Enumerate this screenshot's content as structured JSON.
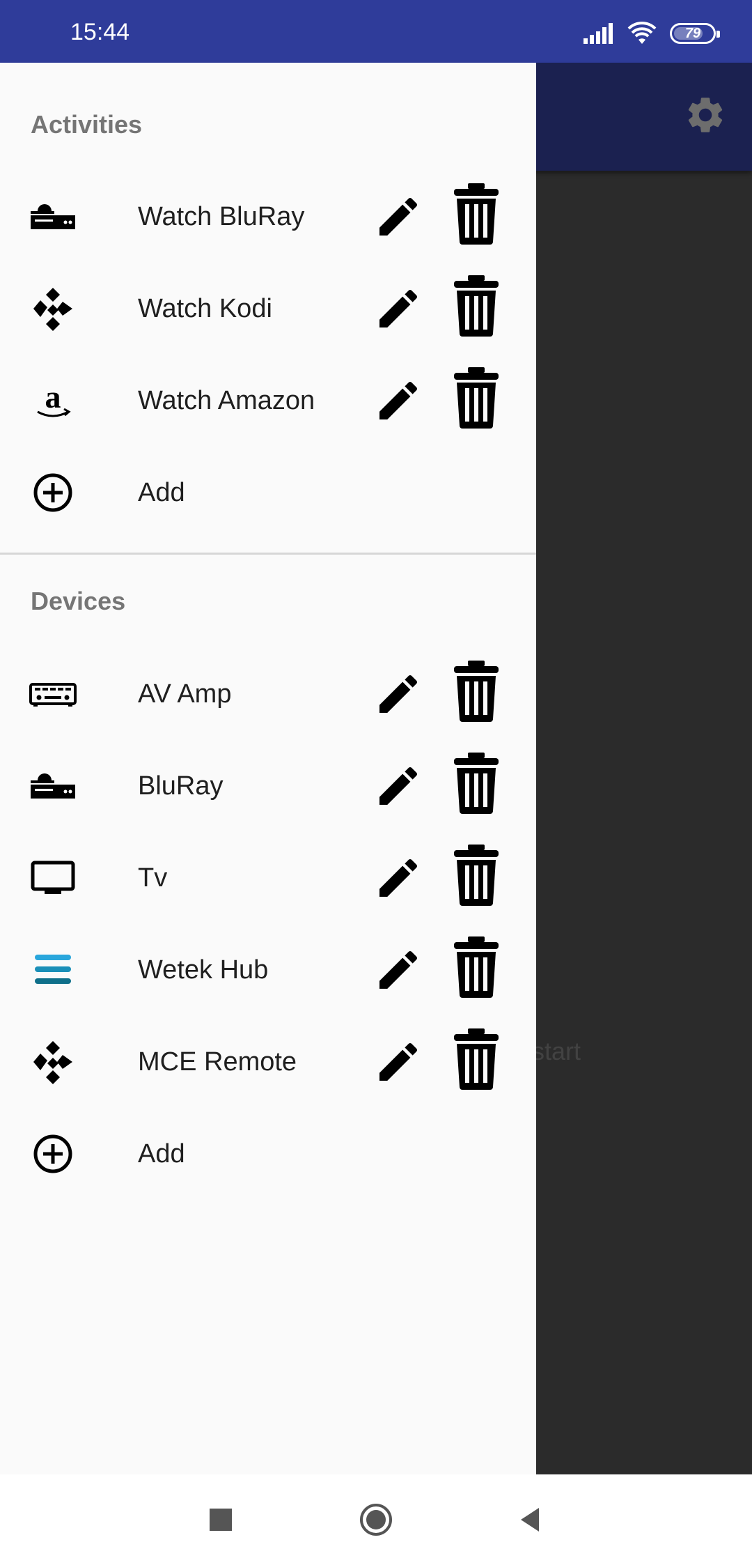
{
  "status_bar": {
    "time": "15:44",
    "battery": "79",
    "battery_level": 0.79
  },
  "app": {
    "toolbar_color": "#1b2150",
    "background_hint": "start"
  },
  "drawer": {
    "activities": {
      "title": "Activities",
      "items": [
        {
          "label": "Watch BluRay",
          "icon": "bluray-player-icon"
        },
        {
          "label": "Watch Kodi",
          "icon": "kodi-icon"
        },
        {
          "label": "Watch Amazon",
          "icon": "amazon-icon"
        }
      ],
      "add_label": "Add"
    },
    "devices": {
      "title": "Devices",
      "items": [
        {
          "label": "AV Amp",
          "icon": "av-receiver-icon"
        },
        {
          "label": "BluRay",
          "icon": "bluray-player-icon"
        },
        {
          "label": "Tv",
          "icon": "tv-icon"
        },
        {
          "label": "Wetek Hub",
          "icon": "wetek-icon"
        },
        {
          "label": "MCE Remote",
          "icon": "kodi-icon"
        }
      ],
      "add_label": "Add"
    }
  },
  "colors": {
    "status_bar": "#2f3c9a",
    "drawer_bg": "#fafafa",
    "scrim": "#2b2b2b",
    "wetek_accent": "#1a8fb8"
  }
}
